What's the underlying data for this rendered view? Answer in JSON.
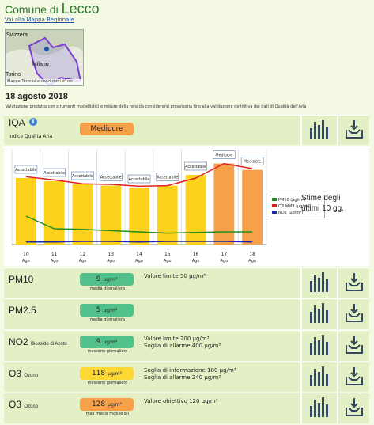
{
  "header": {
    "prefix": "Comune di ",
    "city": "Lecco",
    "back_link": "Vai alla Mappa Regionale"
  },
  "map": {
    "label_switzerland": "Svizzera",
    "label_milano": "Milano",
    "label_torino": "Torino",
    "attribution": "Mappe  Termini e condizioni d'uso"
  },
  "date": "18 agosto 2018",
  "disclaimer": "Valutazione prodotta con strumenti modellistici e misure della rete da considerarsi provvisoria fino alla validazione definitiva dei dati di Qualità dell'Aria",
  "iqa": {
    "name": "IQA",
    "subtitle": "Indice Qualità Aria",
    "badge": "Mediocre",
    "badge_color": "#f7a04a"
  },
  "chart_data": {
    "type": "bar",
    "categories": [
      "10 Ago",
      "11 Ago",
      "12 Ago",
      "13 Ago",
      "14 Ago",
      "15 Ago",
      "16 Ago",
      "17 Ago",
      "18 Ago"
    ],
    "day_labels": [
      "10",
      "11",
      "12",
      "13",
      "14",
      "15",
      "16",
      "17",
      "18"
    ],
    "month_label": "Ago",
    "bar_labels": [
      "Accettabile",
      "Accettabile",
      "Accettabile",
      "Accettabile",
      "Accettabile",
      "Accettabile",
      "Accettabile",
      "Mediocre",
      "Mediocre"
    ],
    "bar_values": [
      105,
      100,
      95,
      93,
      90,
      93,
      110,
      128,
      118
    ],
    "bar_colors": [
      "#fdd21d",
      "#fdd21d",
      "#fdd21d",
      "#fdd21d",
      "#fdd21d",
      "#fdd21d",
      "#fdd21d",
      "#f7a04a",
      "#f7a04a"
    ],
    "ylim": [
      0,
      150
    ],
    "series": [
      {
        "name": "PM10 (µg/m³)",
        "color": "#228b22",
        "values": [
          45,
          25,
          24,
          22,
          20,
          18,
          19,
          20,
          20
        ]
      },
      {
        "name": "O3 MM8 (µg/m³)",
        "color": "#e02020",
        "values": [
          107,
          102,
          96,
          95,
          92,
          93,
          105,
          128,
          120
        ]
      },
      {
        "name": "NO2 (µg/m³)",
        "color": "#1a2aa0",
        "values": [
          4,
          4,
          5,
          5,
          4,
          5,
          5,
          5,
          4
        ]
      }
    ]
  },
  "chart_note": {
    "line1": "Stime degli",
    "line2": "ultimi 10 gg."
  },
  "pollutants": [
    {
      "name": "PM10",
      "sub": "",
      "value": "9",
      "unit": "µg/m³",
      "caption": "media giornaliera",
      "color": "#52c08a",
      "note1": "Valore limite 50 µg/m³",
      "note2": ""
    },
    {
      "name": "PM2.5",
      "sub": "",
      "value": "5",
      "unit": "µg/m³",
      "caption": "media giornaliera",
      "color": "#52c08a",
      "note1": "",
      "note2": ""
    },
    {
      "name": "NO2",
      "sub": "Biossido di Azoto",
      "value": "9",
      "unit": "µg/m³",
      "caption": "massimo giornaliero",
      "color": "#52c08a",
      "note1": "Valore limite 200 µg/m³",
      "note2": "Soglia di allarme 400 µg/m³"
    },
    {
      "name": "O3",
      "sub": "Ozono",
      "value": "118",
      "unit": "µg/m³",
      "caption": "massimo giornaliero",
      "color": "#fdd835",
      "note1": "Soglia di informazione 180 µg/m³",
      "note2": "Soglia di allarme 240 µg/m³"
    },
    {
      "name": "O3",
      "sub": "Ozono",
      "value": "128",
      "unit": "µg/m³",
      "caption": "max media mobile 8h",
      "color": "#f7a04a",
      "note1": "Valore obiettivo 120 µg/m³",
      "note2": ""
    }
  ]
}
